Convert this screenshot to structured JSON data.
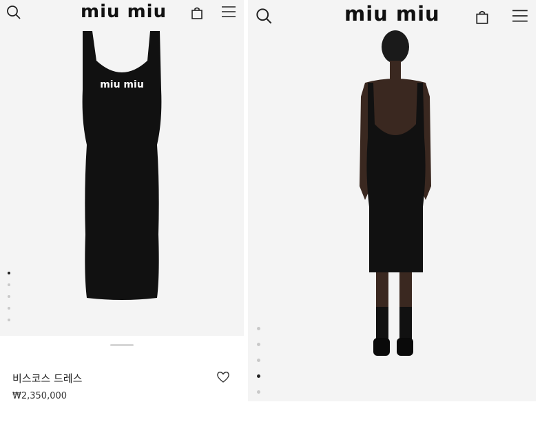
{
  "brand": {
    "logo_text": "miu miu"
  },
  "icons": {
    "search": "search-icon",
    "bag": "shopping-bag-icon",
    "menu": "hamburger-menu-icon",
    "wishlist": "heart-icon"
  },
  "left_panel": {
    "product_title": "비스코스 드레스",
    "price": "₩2,350,000",
    "carousel": {
      "count": 5,
      "active_index": 1
    }
  },
  "right_panel": {
    "carousel": {
      "count": 5,
      "active_index": 4
    }
  },
  "colors": {
    "background": "#f4f4f4",
    "garment": "#111111",
    "text": "#222222"
  }
}
